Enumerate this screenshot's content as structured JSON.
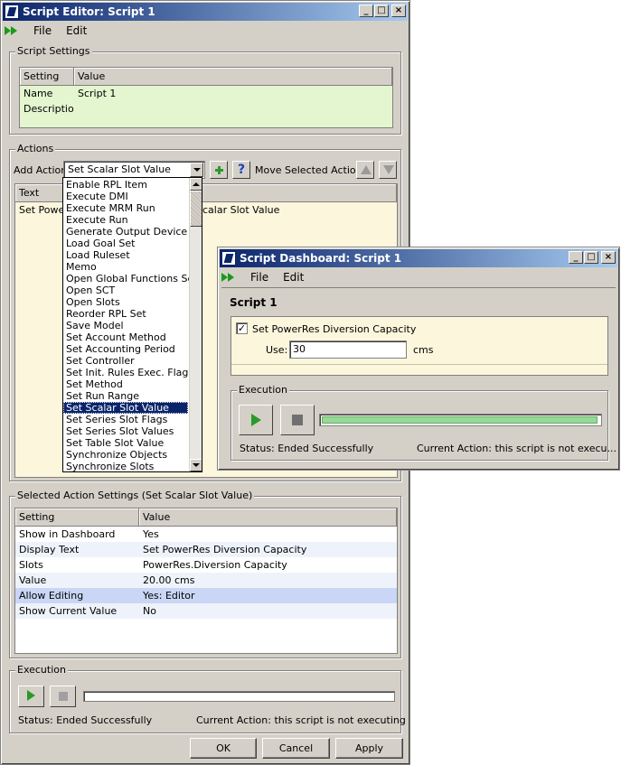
{
  "editor": {
    "title": "Script Editor: Script 1",
    "menu": [
      "File",
      "Edit"
    ],
    "script_settings": {
      "group_label": "Script Settings",
      "columns": [
        "Setting",
        "Value"
      ],
      "rows": [
        {
          "setting": "Name",
          "value": "Script 1"
        },
        {
          "setting": "Description",
          "value": ""
        }
      ]
    },
    "actions": {
      "group_label": "Actions",
      "add_action_label": "Add Action",
      "add_action_value": "Set Scalar Slot Value",
      "help_glyph": "?",
      "move_label": "Move Selected Action:",
      "table_header": "Text",
      "row_text": "Set PowerRes Diversion Capacity",
      "row_visible_left": "Set Power",
      "row_visible_right": "calar Slot Value"
    },
    "dropdown_options": [
      "Enable RPL Item",
      "Execute DMI",
      "Execute MRM Run",
      "Execute Run",
      "Generate Output Device",
      "Load Goal Set",
      "Load Ruleset",
      "Memo",
      "Open Global Functions Set",
      "Open SCT",
      "Open Slots",
      "Reorder RPL Set",
      "Save Model",
      "Set Account Method",
      "Set Accounting Period",
      "Set Controller",
      "Set Init. Rules Exec. Flag",
      "Set Method",
      "Set Run Range",
      "Set Scalar Slot Value",
      "Set Series Slot Flags",
      "Set Series Slot Values",
      "Set Table Slot Value",
      "Synchronize Objects",
      "Synchronize Slots"
    ],
    "selected_action": {
      "group_label": "Selected Action Settings (Set Scalar Slot Value)",
      "columns": [
        "Setting",
        "Value"
      ],
      "rows": [
        {
          "setting": "Show in Dashboard",
          "value": "Yes"
        },
        {
          "setting": "Display Text",
          "value": "Set PowerRes Diversion Capacity"
        },
        {
          "setting": "Slots",
          "value": "PowerRes.Diversion Capacity"
        },
        {
          "setting": "Value",
          "value": "20.00 cms"
        },
        {
          "setting": "Allow Editing",
          "value": "Yes: Editor"
        },
        {
          "setting": "Show Current Value",
          "value": "No"
        }
      ]
    },
    "execution": {
      "group_label": "Execution",
      "progress": 0,
      "status": "Status:  Ended Successfully",
      "current_action": "Current Action:  this script is not executing"
    },
    "buttons": {
      "ok": "OK",
      "cancel": "Cancel",
      "apply": "Apply"
    }
  },
  "dashboard": {
    "title": "Script Dashboard: Script 1",
    "menu": [
      "File",
      "Edit"
    ],
    "script_name": "Script 1",
    "action_label": "Set PowerRes Diversion Capacity",
    "checkmark": "✓",
    "use_label": "Use:",
    "use_value": "30",
    "units": "cms",
    "execution": {
      "group_label": "Execution",
      "progress": 1.0,
      "status": "Status:  Ended Successfully",
      "current_action": "Current Action:  this script is not execu..."
    }
  },
  "colors": {
    "window_bg": "#d4d0c8",
    "title_gradient_start": "#0a246a",
    "title_gradient_end": "#a6caf0",
    "settings_row_bg": "#e3f6cf",
    "actions_area_bg": "#fbf6dc",
    "alt_row_bg": "#eef3fb",
    "selected_row_bg": "#c9d6f5",
    "progress_green": "#98d898"
  }
}
